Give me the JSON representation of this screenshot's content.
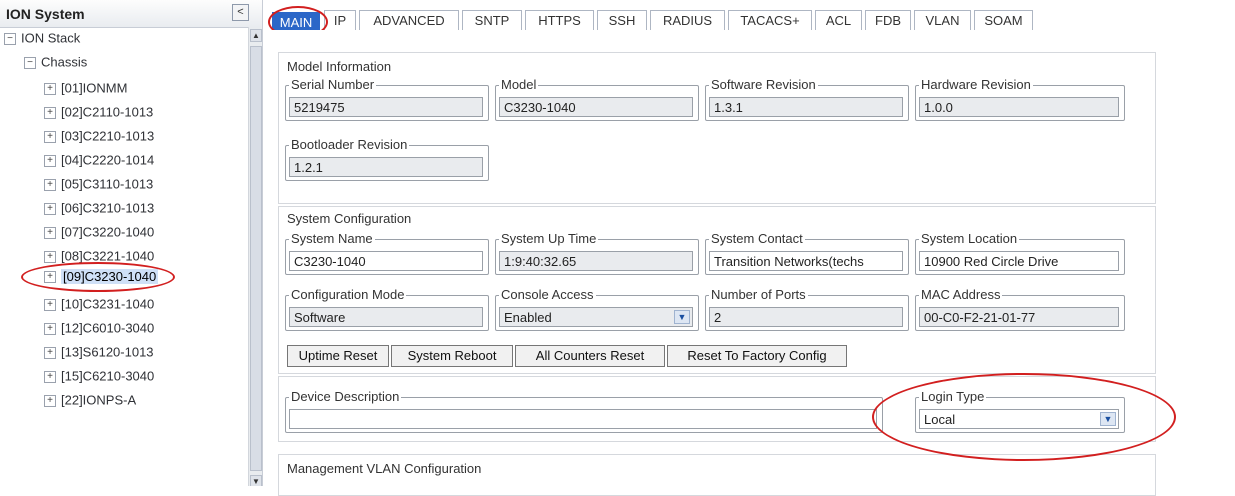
{
  "sidebar": {
    "title": "ION System",
    "collapse_glyph": "<",
    "tree": {
      "root_label": "ION Stack",
      "chassis_label": "Chassis",
      "items": [
        {
          "label": "[01]IONMM"
        },
        {
          "label": "[02]C2110-1013"
        },
        {
          "label": "[03]C2210-1013"
        },
        {
          "label": "[04]C2220-1014"
        },
        {
          "label": "[05]C3110-1013"
        },
        {
          "label": "[06]C3210-1013"
        },
        {
          "label": "[07]C3220-1040"
        },
        {
          "label": "[08]C3221-1040"
        },
        {
          "label": "[09]C3230-1040",
          "selected": true
        },
        {
          "label": "[10]C3231-1040"
        },
        {
          "label": "[12]C6010-3040"
        },
        {
          "label": "[13]S6120-1013"
        },
        {
          "label": "[15]C6210-3040"
        },
        {
          "label": "[22]IONPS-A"
        }
      ]
    }
  },
  "tabs": [
    {
      "label": "MAIN",
      "active": true
    },
    {
      "label": "IP"
    },
    {
      "label": "ADVANCED"
    },
    {
      "label": "SNTP"
    },
    {
      "label": "HTTPS"
    },
    {
      "label": "SSH"
    },
    {
      "label": "RADIUS"
    },
    {
      "label": "TACACS+"
    },
    {
      "label": "ACL"
    },
    {
      "label": "FDB"
    },
    {
      "label": "VLAN"
    },
    {
      "label": "SOAM"
    }
  ],
  "model_info": {
    "title": "Model Information",
    "serial_number": {
      "label": "Serial Number",
      "value": "5219475"
    },
    "model": {
      "label": "Model",
      "value": "C3230-1040"
    },
    "software_revision": {
      "label": "Software Revision",
      "value": "1.3.1"
    },
    "hardware_revision": {
      "label": "Hardware Revision",
      "value": "1.0.0"
    },
    "bootloader_revision": {
      "label": "Bootloader Revision",
      "value": "1.2.1"
    }
  },
  "system_config": {
    "title": "System Configuration",
    "system_name": {
      "label": "System Name",
      "value": "C3230-1040"
    },
    "system_up_time": {
      "label": "System Up Time",
      "value": "1:9:40:32.65"
    },
    "system_contact": {
      "label": "System Contact",
      "value": "Transition Networks(techs"
    },
    "system_location": {
      "label": "System Location",
      "value": "10900 Red Circle Drive"
    },
    "configuration_mode": {
      "label": "Configuration Mode",
      "value": "Software"
    },
    "console_access": {
      "label": "Console Access",
      "value": "Enabled"
    },
    "number_of_ports": {
      "label": "Number of Ports",
      "value": "2"
    },
    "mac_address": {
      "label": "MAC Address",
      "value": "00-C0-F2-21-01-77"
    },
    "buttons": {
      "uptime_reset": "Uptime Reset",
      "system_reboot": "System Reboot",
      "all_counters_reset": "All Counters Reset",
      "reset_factory": "Reset To Factory Config"
    }
  },
  "device": {
    "description": {
      "label": "Device Description",
      "value": ""
    },
    "login_type": {
      "label": "Login Type",
      "value": "Local"
    }
  },
  "mgmt_vlan": {
    "title": "Management VLAN Configuration"
  },
  "colors": {
    "active_tab": "#2b67c8",
    "annotation_ring": "#d21f1f",
    "readonly_field": "#e9ebee"
  }
}
